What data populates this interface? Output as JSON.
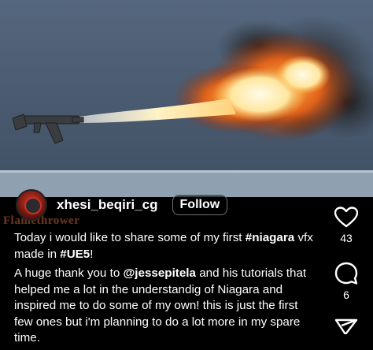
{
  "post": {
    "author": "xhesi_beqiri_cg",
    "follow_label": "Follow",
    "watermark": "Flamethrower",
    "caption": {
      "p1_start": "Today i would like to share some of my first ",
      "p1_tag1": "#niagara",
      "p1_mid": " vfx made in ",
      "p1_tag2": "#UE5",
      "p1_end": "!",
      "p2_start": "A huge thank you to ",
      "p2_mention": "@jessepitela",
      "p2_end": " and his tutorials that helped me a lot in the understandig of Niagara and inspired me to do some of my own! this is just the first few ones but i'm planning to do a lot more in my spare time."
    }
  },
  "actions": {
    "like_count": "43",
    "comment_count": "6",
    "icons": [
      "heart-icon",
      "comment-icon",
      "share-icon"
    ]
  },
  "colors": {
    "background": "#000000",
    "text": "#ffffff",
    "fire_core": "#fff6d0",
    "fire_outer": "#e05a12",
    "smoke": "#2b2b2b"
  }
}
